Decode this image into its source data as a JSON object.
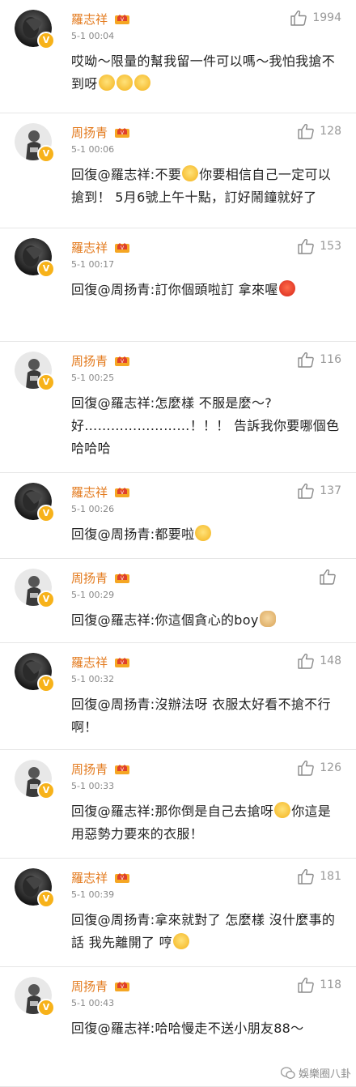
{
  "comments": [
    {
      "user": "羅志祥",
      "avatar": "dark",
      "time": "5-1 00:04",
      "likes": "1994",
      "height": 140,
      "segments": [
        {
          "t": "哎呦～限量的幫我留一件可以嗎～我怕我搶不到呀"
        },
        {
          "e": "scream-icon"
        },
        {
          "e": "scream-icon"
        },
        {
          "e": "scream-icon"
        }
      ]
    },
    {
      "user": "周扬青",
      "avatar": "light",
      "time": "5-1 00:06",
      "likes": "128",
      "height": 142,
      "segments": [
        {
          "t": "回復@羅志祥:不要"
        },
        {
          "e": "smirk-icon"
        },
        {
          "t": "你要相信自己一定可以搶到！ 5月6號上午十點，訂好鬧鐘就好了"
        }
      ]
    },
    {
      "user": "羅志祥",
      "avatar": "dark",
      "time": "5-1 00:17",
      "likes": "153",
      "height": 140,
      "segments": [
        {
          "t": "回復@周扬青:訂你個頭啦訂 拿來喔"
        },
        {
          "e": "angry-icon"
        }
      ]
    },
    {
      "user": "周扬青",
      "avatar": "light",
      "time": "5-1 00:25",
      "likes": "116",
      "height": 162,
      "segments": [
        {
          "t": "回復@羅志祥:怎麼樣 不服是麼～?好……………………！！！ 告訴我你要哪個色 哈哈哈"
        }
      ]
    },
    {
      "user": "羅志祥",
      "avatar": "dark",
      "time": "5-1 00:26",
      "likes": "137",
      "height": 106,
      "segments": [
        {
          "t": "回復@周扬青:都要啦"
        },
        {
          "e": "huff-icon"
        }
      ]
    },
    {
      "user": "周扬青",
      "avatar": "light",
      "time": "5-1 00:29",
      "likes": "",
      "height": 104,
      "segments": [
        {
          "t": "回復@羅志祥:你這個貪心的boy"
        },
        {
          "e": "dog-icon"
        }
      ]
    },
    {
      "user": "羅志祥",
      "avatar": "dark",
      "time": "5-1 00:32",
      "likes": "148",
      "height": 132,
      "segments": [
        {
          "t": "回復@周扬青:沒辦法呀 衣服太好看不搶不行啊！"
        }
      ]
    },
    {
      "user": "周扬青",
      "avatar": "light",
      "time": "5-1 00:33",
      "likes": "126",
      "height": 134,
      "segments": [
        {
          "t": "回復@羅志祥:那你倒是自己去搶呀"
        },
        {
          "e": "laugh-icon"
        },
        {
          "t": "你這是用惡勢力要來的衣服！"
        }
      ]
    },
    {
      "user": "羅志祥",
      "avatar": "dark",
      "time": "5-1 00:39",
      "likes": "181",
      "height": 134,
      "segments": [
        {
          "t": "回復@周扬青:拿來就對了 怎麼樣 沒什麼事的話 我先離開了 哼"
        },
        {
          "e": "huff-icon"
        }
      ]
    },
    {
      "user": "周扬青",
      "avatar": "light",
      "time": "5-1 00:43",
      "likes": "118",
      "height": 148,
      "segments": [
        {
          "t": "回復@羅志祥:哈哈慢走不送小朋友88～"
        }
      ]
    }
  ],
  "watermark": "娛樂圈八卦"
}
